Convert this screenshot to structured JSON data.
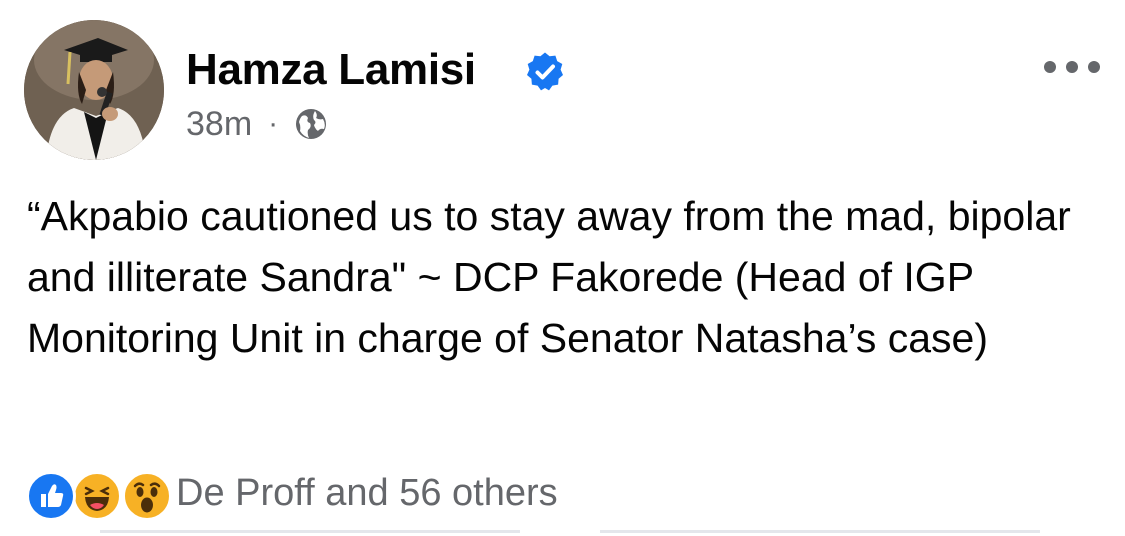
{
  "post": {
    "author": {
      "name": "Hamza Lamisi",
      "verified": true,
      "avatar_icon": "profile-photo"
    },
    "meta": {
      "time": "38m",
      "separator": "·",
      "audience_icon": "globe-icon"
    },
    "text": "“Akpabio cautioned us to stay away from the mad, bipolar and illiterate Sandra\" ~ DCP Fakorede (Head of IGP Monitoring Unit in charge of Senator Natasha’s case)",
    "reactions": {
      "icons": [
        "like-icon",
        "haha-icon",
        "wow-icon"
      ],
      "summary": "De Proff and 56 others"
    }
  },
  "colors": {
    "primary_text": "#050505",
    "secondary_text": "#65676b",
    "brand_blue": "#1877f2",
    "reaction_yellow": "#f7b125"
  }
}
